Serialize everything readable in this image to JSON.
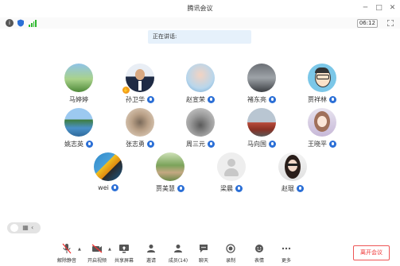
{
  "window": {
    "title": "腾讯会议"
  },
  "status": {
    "time": "06:12"
  },
  "speaking": {
    "label": "正在讲话:"
  },
  "participants": [
    {
      "name": "马婷婷"
    },
    {
      "name": "孙卫华"
    },
    {
      "name": "赵宣荣"
    },
    {
      "name": "褚东亮"
    },
    {
      "name": "贾祥林"
    },
    {
      "name": "姚志英"
    },
    {
      "name": "张志勇"
    },
    {
      "name": "周三元"
    },
    {
      "name": "马向国"
    },
    {
      "name": "王晓平"
    },
    {
      "name": "wei"
    },
    {
      "name": "贾美慧"
    },
    {
      "name": "梁晨"
    },
    {
      "name": "赵琨"
    }
  ],
  "toolbar": {
    "unmute": "解除静音",
    "video": "开启视频",
    "share": "共享屏幕",
    "invite": "邀请",
    "members": "成员(14)",
    "chat": "聊天",
    "record": "录制",
    "reactions": "表情",
    "more": "更多",
    "leave": "离开会议"
  },
  "colors": {
    "mic": "#2b6fd6",
    "leave": "#e33333",
    "speaking_bg": "#e6f1fb"
  }
}
